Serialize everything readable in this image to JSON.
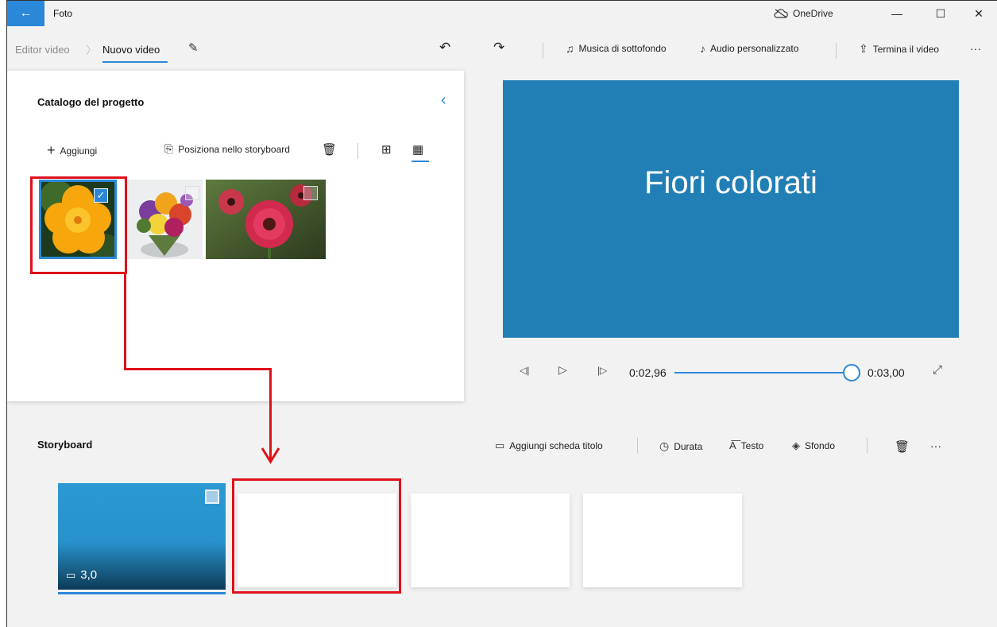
{
  "window": {
    "app_title": "Foto",
    "back_icon": "back-arrow-icon",
    "onedrive_label": "OneDrive",
    "controls": [
      "minimize",
      "maximize",
      "close"
    ]
  },
  "breadcrumb": {
    "parent": "Editor video",
    "current": "Nuovo video"
  },
  "toolbar": {
    "music_label": "Musica di sottofondo",
    "custom_audio_label": "Audio personalizzato",
    "finish_label": "Termina il video",
    "more": "···"
  },
  "library": {
    "title": "Catalogo del progetto",
    "add_label": "Aggiungi",
    "place_label": "Posiziona nello storyboard",
    "items": [
      {
        "name": "yellow-flower",
        "selected": true
      },
      {
        "name": "flower-bouquet",
        "selected": false
      },
      {
        "name": "red-gerbera",
        "selected": false
      }
    ]
  },
  "preview": {
    "title_text": "Fiori colorati",
    "current_time": "0:02,96",
    "end_time": "0:03,00",
    "progress": 0.987
  },
  "storyboard": {
    "title": "Storyboard",
    "add_title_card_label": "Aggiungi scheda titolo",
    "duration_label": "Durata",
    "text_label": "Testo",
    "background_label": "Sfondo",
    "more": "···",
    "cards": [
      {
        "duration": "3,0",
        "color": "#2b99d3"
      },
      {
        "duration": ""
      },
      {
        "duration": ""
      },
      {
        "duration": ""
      }
    ]
  },
  "colors": {
    "accent": "#2b88d8",
    "preview_bg": "#217fb5",
    "annotation": "#e0101a"
  }
}
